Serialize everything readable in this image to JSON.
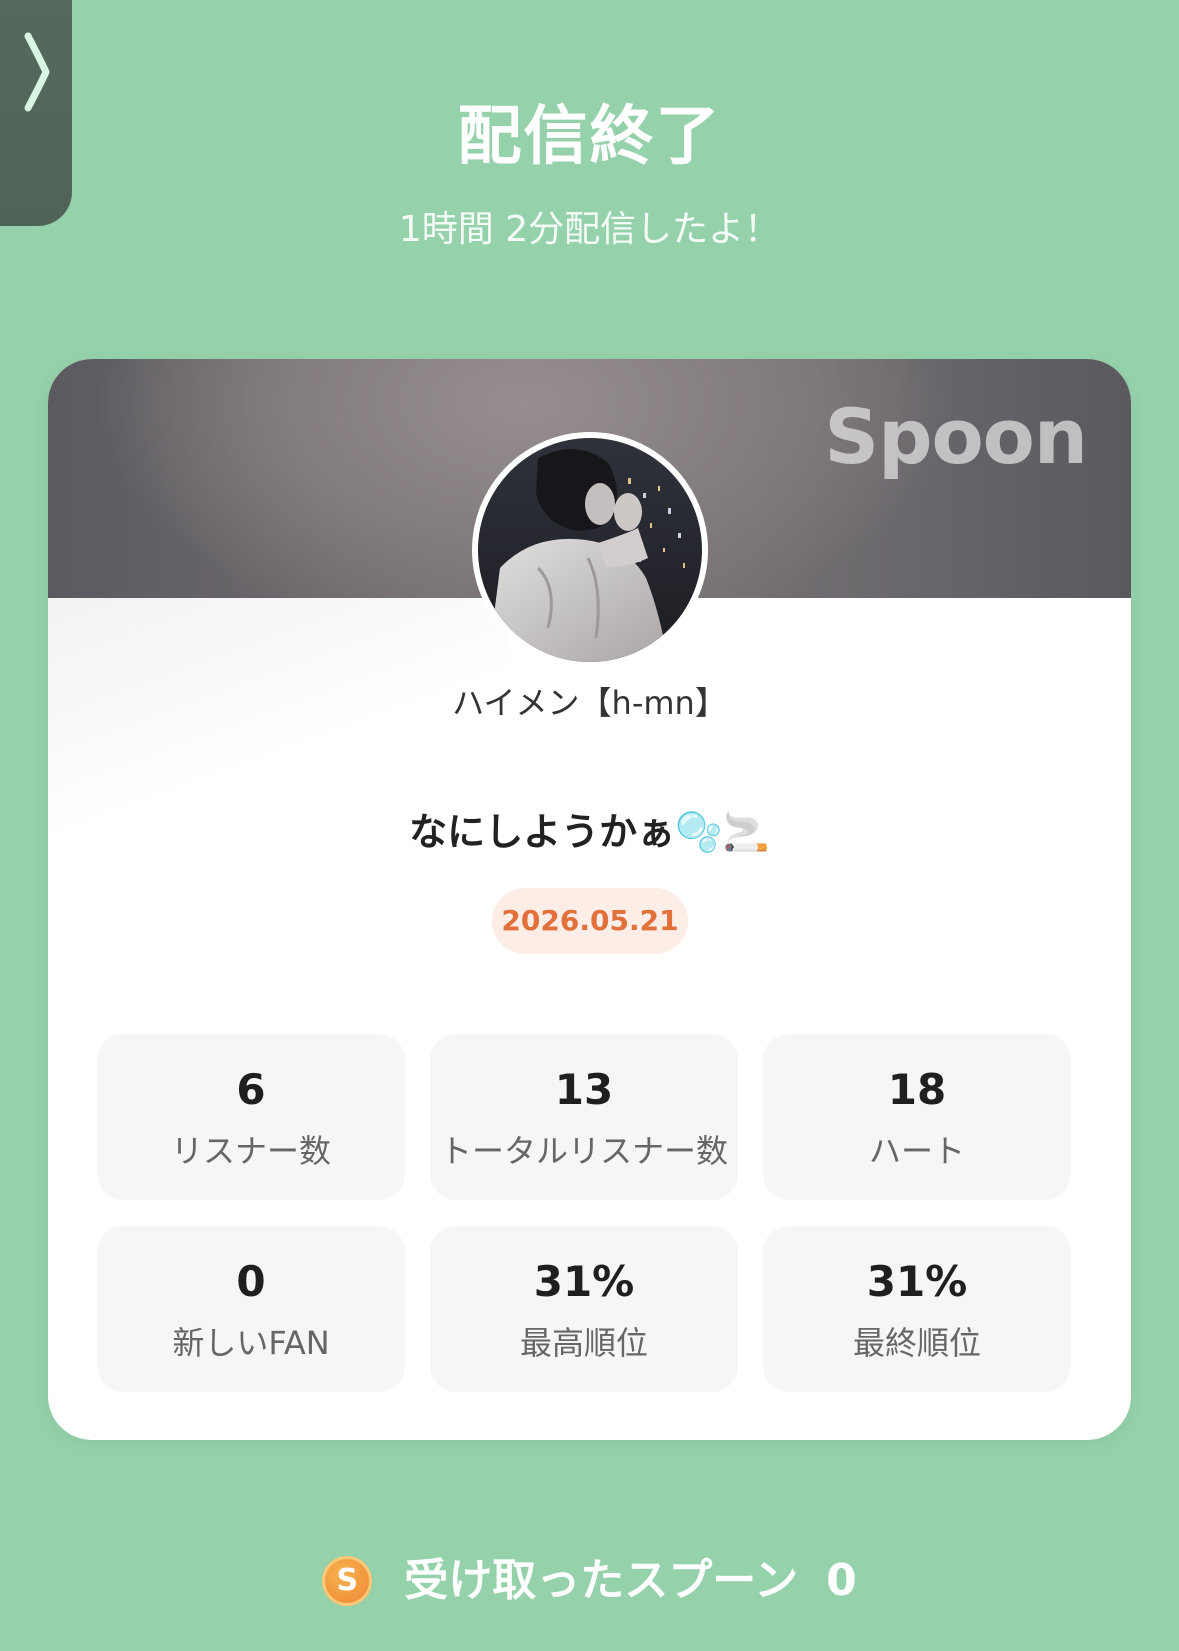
{
  "side_tab": {
    "icon": "chevron-right-icon"
  },
  "header": {
    "title": "配信終了",
    "subtitle": "1時間 2分配信したよ！"
  },
  "card": {
    "brand": "Spoon",
    "user_name": "ハイメン【h-mn】",
    "broadcast_title": "なにしようかぁ🫧🚬",
    "date": "2026.05.21",
    "stats": [
      {
        "value": "6",
        "label": "リスナー数"
      },
      {
        "value": "13",
        "label": "トータルリスナー数"
      },
      {
        "value": "18",
        "label": "ハート"
      },
      {
        "value": "0",
        "label": "新しいFAN"
      },
      {
        "value": "31%",
        "label": "最高順位"
      },
      {
        "value": "31%",
        "label": "最終順位"
      }
    ]
  },
  "footer": {
    "coin_icon": "spoon-coin-icon",
    "coin_symbol": "S",
    "label": "受け取ったスプーン",
    "count": "0"
  },
  "colors": {
    "background": "#95D2AB",
    "date_text": "#E2703B",
    "date_pill_bg": "#FCEDE6",
    "stat_box_bg": "#F6F6F6",
    "coin": "#F0913A"
  }
}
